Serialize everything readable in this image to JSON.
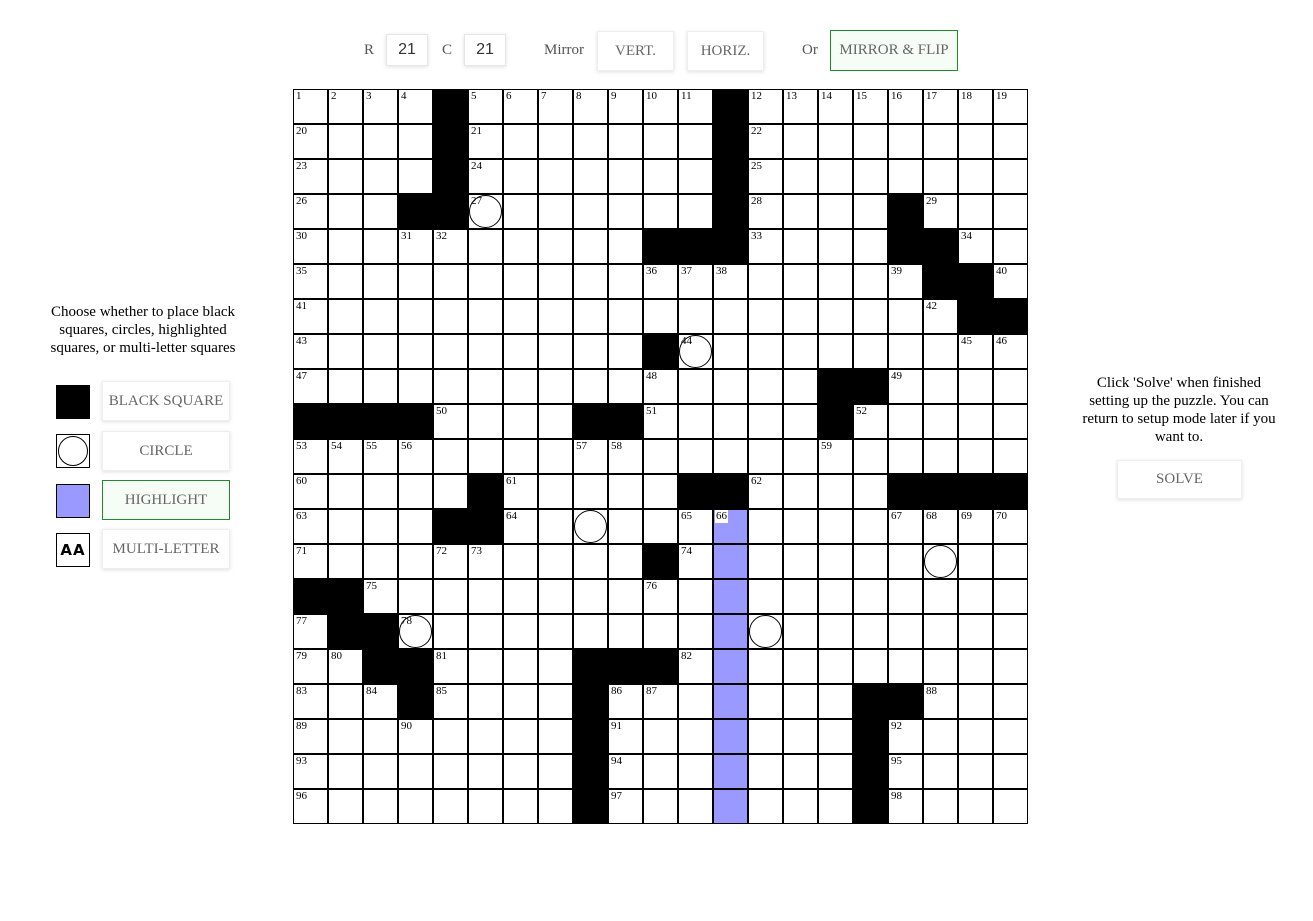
{
  "header": {
    "rows_label": "R",
    "rows_value": "21",
    "cols_label": "C",
    "cols_value": "21",
    "mirror_label": "Mirror",
    "vert_label": "VERT.",
    "horiz_label": "HORIZ.",
    "or_label": "Or",
    "mirror_flip_label": "MIRROR & FLIP"
  },
  "left_panel": {
    "instructions": "Choose whether to place black squares, circles, highlighted squares, or multi-letter squares",
    "black_square_label": "BLACK SQUARE",
    "circle_label": "CIRCLE",
    "highlight_label": "HIGHLIGHT",
    "multi_letter_label": "MULTI-LETTER",
    "multi_letter_icon_text": "AA",
    "highlight_color": "#9a99ff",
    "active_mode_color": "#1e8c2d"
  },
  "right_panel": {
    "instructions": "Click 'Solve' when finished setting up the puzzle. You can return to setup mode later if you want to.",
    "solve_label": "SOLVE"
  },
  "grid": {
    "rows": 21,
    "cols": 21,
    "black": [
      [
        0,
        4
      ],
      [
        0,
        12
      ],
      [
        1,
        4
      ],
      [
        1,
        12
      ],
      [
        2,
        4
      ],
      [
        2,
        12
      ],
      [
        3,
        3
      ],
      [
        3,
        4
      ],
      [
        3,
        12
      ],
      [
        3,
        17
      ],
      [
        4,
        10
      ],
      [
        4,
        11
      ],
      [
        4,
        12
      ],
      [
        4,
        17
      ],
      [
        4,
        18
      ],
      [
        5,
        18
      ],
      [
        5,
        19
      ],
      [
        6,
        19
      ],
      [
        6,
        20
      ],
      [
        7,
        10
      ],
      [
        8,
        15
      ],
      [
        8,
        16
      ],
      [
        9,
        0
      ],
      [
        9,
        1
      ],
      [
        9,
        2
      ],
      [
        9,
        3
      ],
      [
        9,
        8
      ],
      [
        9,
        9
      ],
      [
        9,
        15
      ],
      [
        11,
        5
      ],
      [
        11,
        11
      ],
      [
        11,
        12
      ],
      [
        11,
        17
      ],
      [
        11,
        18
      ],
      [
        11,
        19
      ],
      [
        11,
        20
      ],
      [
        12,
        4
      ],
      [
        12,
        5
      ],
      [
        13,
        10
      ],
      [
        14,
        0
      ],
      [
        14,
        1
      ],
      [
        15,
        1
      ],
      [
        15,
        2
      ],
      [
        16,
        2
      ],
      [
        16,
        3
      ],
      [
        16,
        8
      ],
      [
        16,
        9
      ],
      [
        16,
        10
      ],
      [
        17,
        3
      ],
      [
        17,
        8
      ],
      [
        17,
        16
      ],
      [
        17,
        17
      ],
      [
        18,
        8
      ],
      [
        18,
        16
      ],
      [
        19,
        8
      ],
      [
        19,
        16
      ],
      [
        20,
        8
      ],
      [
        20,
        16
      ]
    ],
    "circles": [
      [
        3,
        5
      ],
      [
        7,
        11
      ],
      [
        12,
        8
      ],
      [
        13,
        18
      ],
      [
        15,
        3
      ],
      [
        15,
        13
      ]
    ],
    "highlight": [
      [
        12,
        12
      ],
      [
        13,
        12
      ],
      [
        14,
        12
      ],
      [
        15,
        12
      ],
      [
        16,
        12
      ],
      [
        17,
        12
      ],
      [
        18,
        12
      ],
      [
        19,
        12
      ],
      [
        20,
        12
      ]
    ],
    "numbers": [
      [
        0,
        0,
        "1"
      ],
      [
        0,
        1,
        "2"
      ],
      [
        0,
        2,
        "3"
      ],
      [
        0,
        3,
        "4"
      ],
      [
        0,
        5,
        "5"
      ],
      [
        0,
        6,
        "6"
      ],
      [
        0,
        7,
        "7"
      ],
      [
        0,
        8,
        "8"
      ],
      [
        0,
        9,
        "9"
      ],
      [
        0,
        10,
        "10"
      ],
      [
        0,
        11,
        "11"
      ],
      [
        0,
        13,
        "12"
      ],
      [
        0,
        14,
        "13"
      ],
      [
        0,
        15,
        "14"
      ],
      [
        0,
        16,
        "15"
      ],
      [
        0,
        17,
        "16"
      ],
      [
        0,
        18,
        "17"
      ],
      [
        0,
        19,
        "18"
      ],
      [
        0,
        20,
        "19"
      ],
      [
        1,
        0,
        "20"
      ],
      [
        1,
        5,
        "21"
      ],
      [
        1,
        13,
        "22"
      ],
      [
        2,
        0,
        "23"
      ],
      [
        2,
        5,
        "24"
      ],
      [
        2,
        13,
        "25"
      ],
      [
        3,
        0,
        "26"
      ],
      [
        3,
        5,
        "27"
      ],
      [
        3,
        13,
        "28"
      ],
      [
        3,
        18,
        "29"
      ],
      [
        4,
        0,
        "30"
      ],
      [
        4,
        3,
        "31"
      ],
      [
        4,
        4,
        "32"
      ],
      [
        4,
        13,
        "33"
      ],
      [
        4,
        19,
        "34"
      ],
      [
        5,
        0,
        "35"
      ],
      [
        5,
        10,
        "36"
      ],
      [
        5,
        11,
        "37"
      ],
      [
        5,
        12,
        "38"
      ],
      [
        5,
        17,
        "39"
      ],
      [
        5,
        20,
        "40"
      ],
      [
        6,
        0,
        "41"
      ],
      [
        6,
        18,
        "42"
      ],
      [
        7,
        0,
        "43"
      ],
      [
        7,
        11,
        "44"
      ],
      [
        7,
        19,
        "45"
      ],
      [
        7,
        20,
        "46"
      ],
      [
        8,
        0,
        "47"
      ],
      [
        8,
        10,
        "48"
      ],
      [
        8,
        17,
        "49"
      ],
      [
        9,
        4,
        "50"
      ],
      [
        9,
        10,
        "51"
      ],
      [
        9,
        16,
        "52"
      ],
      [
        10,
        0,
        "53"
      ],
      [
        10,
        1,
        "54"
      ],
      [
        10,
        2,
        "55"
      ],
      [
        10,
        3,
        "56"
      ],
      [
        10,
        8,
        "57"
      ],
      [
        10,
        9,
        "58"
      ],
      [
        10,
        15,
        "59"
      ],
      [
        11,
        0,
        "60"
      ],
      [
        11,
        6,
        "61"
      ],
      [
        11,
        13,
        "62"
      ],
      [
        12,
        0,
        "63"
      ],
      [
        12,
        6,
        "64"
      ],
      [
        12,
        11,
        "65"
      ],
      [
        12,
        12,
        "66"
      ],
      [
        12,
        17,
        "67"
      ],
      [
        12,
        18,
        "68"
      ],
      [
        12,
        19,
        "69"
      ],
      [
        12,
        20,
        "70"
      ],
      [
        13,
        0,
        "71"
      ],
      [
        13,
        4,
        "72"
      ],
      [
        13,
        5,
        "73"
      ],
      [
        13,
        11,
        "74"
      ],
      [
        14,
        2,
        "75"
      ],
      [
        14,
        10,
        "76"
      ],
      [
        15,
        0,
        "77"
      ],
      [
        15,
        3,
        "78"
      ],
      [
        16,
        0,
        "79"
      ],
      [
        16,
        1,
        "80"
      ],
      [
        16,
        4,
        "81"
      ],
      [
        16,
        11,
        "82"
      ],
      [
        17,
        0,
        "83"
      ],
      [
        17,
        2,
        "84"
      ],
      [
        17,
        4,
        "85"
      ],
      [
        17,
        9,
        "86"
      ],
      [
        17,
        10,
        "87"
      ],
      [
        17,
        18,
        "88"
      ],
      [
        18,
        0,
        "89"
      ],
      [
        18,
        3,
        "90"
      ],
      [
        18,
        9,
        "91"
      ],
      [
        18,
        17,
        "92"
      ],
      [
        19,
        0,
        "93"
      ],
      [
        19,
        9,
        "94"
      ],
      [
        19,
        17,
        "95"
      ],
      [
        20,
        0,
        "96"
      ],
      [
        20,
        9,
        "97"
      ],
      [
        20,
        17,
        "98"
      ]
    ]
  }
}
